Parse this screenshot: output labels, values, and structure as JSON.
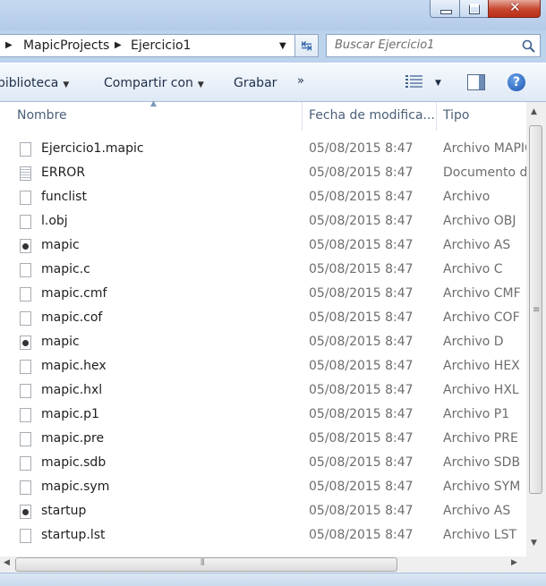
{
  "address": {
    "crumbs": [
      "MapicProjects",
      "Ejercicio1"
    ]
  },
  "search": {
    "placeholder": "Buscar Ejercicio1"
  },
  "toolbar": {
    "library": "biblioteca",
    "share": "Compartir con",
    "burn": "Grabar",
    "more": "»",
    "help": "?"
  },
  "columns": {
    "name": "Nombre",
    "date": "Fecha de modifica...",
    "type": "Tipo"
  },
  "files": [
    {
      "name": "Ejercicio1.mapic",
      "date": "05/08/2015 8:47",
      "type": "Archivo MAPIC",
      "icon": "blank"
    },
    {
      "name": "ERROR",
      "date": "05/08/2015 8:47",
      "type": "Documento d",
      "icon": "text"
    },
    {
      "name": "funclist",
      "date": "05/08/2015 8:47",
      "type": "Archivo",
      "icon": "blank"
    },
    {
      "name": "l.obj",
      "date": "05/08/2015 8:47",
      "type": "Archivo OBJ",
      "icon": "blank"
    },
    {
      "name": "mapic",
      "date": "05/08/2015 8:47",
      "type": "Archivo AS",
      "icon": "dot"
    },
    {
      "name": "mapic.c",
      "date": "05/08/2015 8:47",
      "type": "Archivo C",
      "icon": "blank"
    },
    {
      "name": "mapic.cmf",
      "date": "05/08/2015 8:47",
      "type": "Archivo CMF",
      "icon": "blank"
    },
    {
      "name": "mapic.cof",
      "date": "05/08/2015 8:47",
      "type": "Archivo COF",
      "icon": "blank"
    },
    {
      "name": "mapic",
      "date": "05/08/2015 8:47",
      "type": "Archivo D",
      "icon": "dot"
    },
    {
      "name": "mapic.hex",
      "date": "05/08/2015 8:47",
      "type": "Archivo HEX",
      "icon": "blank"
    },
    {
      "name": "mapic.hxl",
      "date": "05/08/2015 8:47",
      "type": "Archivo HXL",
      "icon": "blank"
    },
    {
      "name": "mapic.p1",
      "date": "05/08/2015 8:47",
      "type": "Archivo P1",
      "icon": "blank"
    },
    {
      "name": "mapic.pre",
      "date": "05/08/2015 8:47",
      "type": "Archivo PRE",
      "icon": "blank"
    },
    {
      "name": "mapic.sdb",
      "date": "05/08/2015 8:47",
      "type": "Archivo SDB",
      "icon": "blank"
    },
    {
      "name": "mapic.sym",
      "date": "05/08/2015 8:47",
      "type": "Archivo SYM",
      "icon": "blank"
    },
    {
      "name": "startup",
      "date": "05/08/2015 8:47",
      "type": "Archivo AS",
      "icon": "dot"
    },
    {
      "name": "startup.lst",
      "date": "05/08/2015 8:47",
      "type": "Archivo LST",
      "icon": "blank"
    }
  ]
}
